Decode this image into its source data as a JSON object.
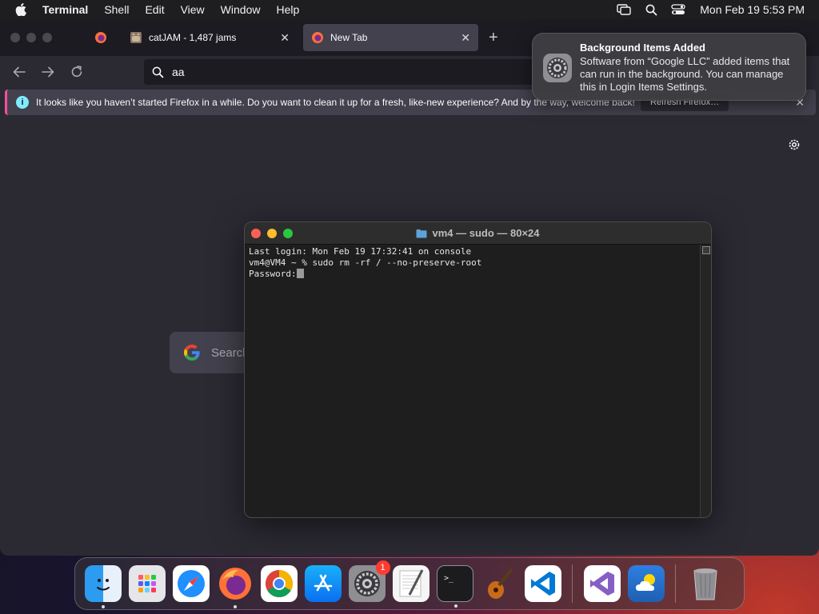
{
  "menubar": {
    "app_name": "Terminal",
    "items": [
      "Shell",
      "Edit",
      "View",
      "Window",
      "Help"
    ],
    "clock": "Mon Feb 19  5:53 PM"
  },
  "firefox": {
    "tabs": [
      {
        "title": "catJAM - 1,487 jams",
        "active": false
      },
      {
        "title": "New Tab",
        "active": true
      }
    ],
    "url_text": "aa",
    "infobar": {
      "message": "It looks like you haven’t started Firefox in a while. Do you want to clean it up for a fresh, like-new experience? And by the way, welcome back!",
      "button": "Refresh Firefox…"
    },
    "search_placeholder": "Search"
  },
  "notification": {
    "title": "Background Items Added",
    "body": "Software from “Google LLC” added items that can run in the background. You can manage this in Login Items Settings."
  },
  "terminal": {
    "title": "vm4 — sudo — 80×24",
    "lines": [
      "Last login: Mon Feb 19 17:32:41 on console",
      "vm4@VM4 ~ % sudo rm -rf / --no-preserve-root"
    ],
    "prompt": "Password:"
  },
  "dock": {
    "apps": [
      "Finder",
      "Launchpad",
      "Safari",
      "Firefox",
      "Google Chrome",
      "App Store",
      "System Settings",
      "TextEdit",
      "Terminal",
      "GarageBand",
      "Visual Studio Code",
      "Visual Studio",
      "Weather",
      "Trash"
    ],
    "settings_badge": "1"
  }
}
